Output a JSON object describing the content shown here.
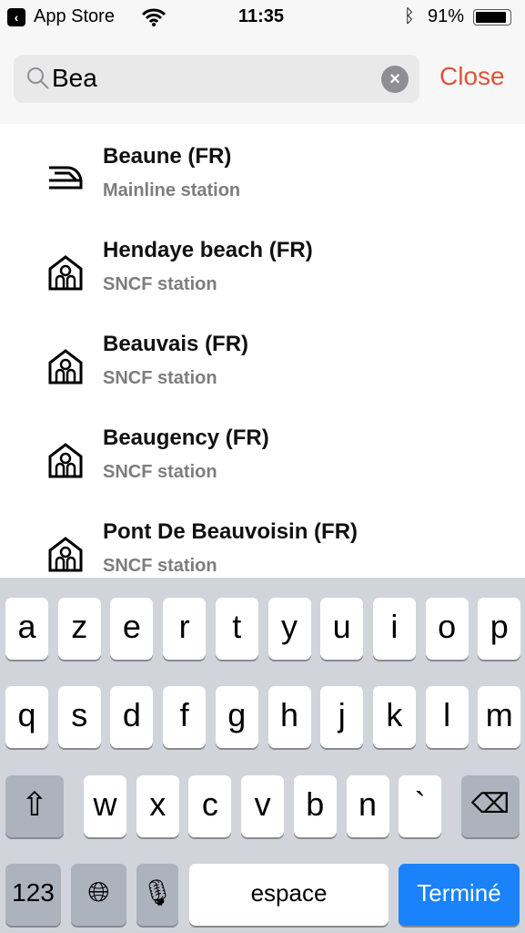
{
  "status": {
    "back_label": "App Store",
    "time": "11:35",
    "battery": "91%"
  },
  "search": {
    "value": "Bea",
    "close_label": "Close"
  },
  "results": [
    {
      "title": "Beaune (FR)",
      "subtitle": "Mainline station",
      "icon": "train-icon"
    },
    {
      "title": "Hendaye beach (FR)",
      "subtitle": "SNCF station",
      "icon": "station-icon"
    },
    {
      "title": "Beauvais (FR)",
      "subtitle": "SNCF station",
      "icon": "station-icon"
    },
    {
      "title": "Beaugency (FR)",
      "subtitle": "SNCF station",
      "icon": "station-icon"
    },
    {
      "title": "Pont De Beauvoisin (FR)",
      "subtitle": "SNCF station",
      "icon": "station-icon"
    }
  ],
  "keyboard": {
    "row1": [
      "a",
      "z",
      "e",
      "r",
      "t",
      "y",
      "u",
      "i",
      "o",
      "p"
    ],
    "row2": [
      "q",
      "s",
      "d",
      "f",
      "g",
      "h",
      "j",
      "k",
      "l",
      "m"
    ],
    "row3": [
      "w",
      "x",
      "c",
      "v",
      "b",
      "n",
      "`"
    ],
    "numbers": "123",
    "space": "espace",
    "done": "Terminé",
    "done_color": "#1a82fb"
  }
}
